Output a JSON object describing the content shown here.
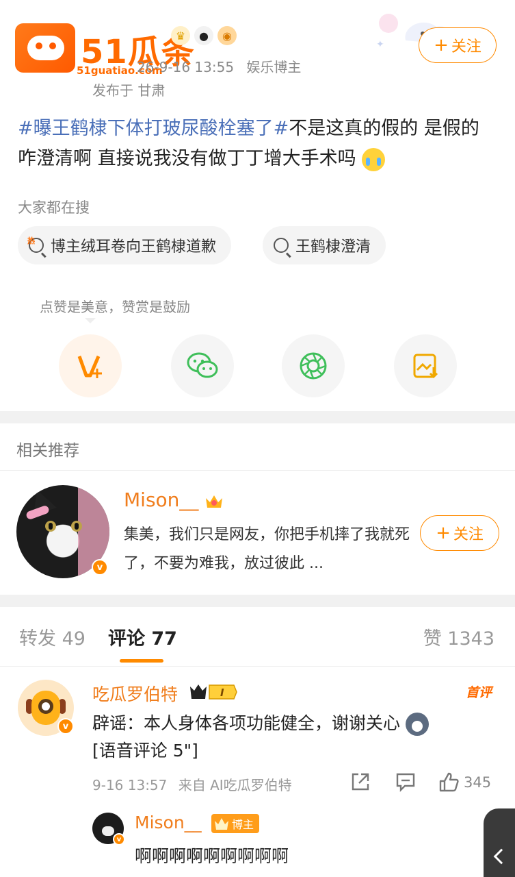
{
  "header": {
    "watermark": {
      "brand": "51瓜条",
      "url": "51guatiao.com"
    },
    "post_time": "26-9-16 13:55",
    "user_role": "娱乐博主",
    "location": "发布于 甘肃",
    "follow_label": "关注"
  },
  "post": {
    "hashtag": "#曝王鹤棣下体打玻尿酸栓塞了#",
    "text": "不是这真的假的 是假的咋澄清啊 直接说我没有做丁丁增大手术吗"
  },
  "search": {
    "title": "大家都在搜",
    "chips": [
      {
        "label": "博主绒耳卷向王鹤棣道歉",
        "hot": "热"
      },
      {
        "label": "王鹤棣澄清"
      }
    ]
  },
  "share": {
    "tip": "点赞是美意，赞赏是鼓励",
    "actions": [
      "reward-icon",
      "wechat-icon",
      "moments-icon",
      "save-image-icon"
    ]
  },
  "recommend": {
    "title": "相关推荐",
    "name": "Mison__",
    "desc": "集美，我们只是网友，你把手机摔了我就死了，不要为难我，放过彼此 ...",
    "follow_label": "关注"
  },
  "tabs": {
    "repost": "转发 49",
    "comment": "评论 77",
    "like": "赞 1343"
  },
  "comment": {
    "name": "吃瓜罗伯特",
    "level": "I",
    "first_badge": "首评",
    "text": "辟谣：本人身体各项功能健全，谢谢关心",
    "voice": "[语音评论 5\"]",
    "time": "9-16 13:57",
    "source": "来自 AI吃瓜罗伯特",
    "likes": "345",
    "reply": {
      "name": "Mison__",
      "badge": "博主",
      "text": "啊啊啊啊啊啊啊啊啊"
    }
  },
  "colors": {
    "accent": "#ff8a00",
    "name": "#f07d1c",
    "link": "#4a6fb8"
  }
}
